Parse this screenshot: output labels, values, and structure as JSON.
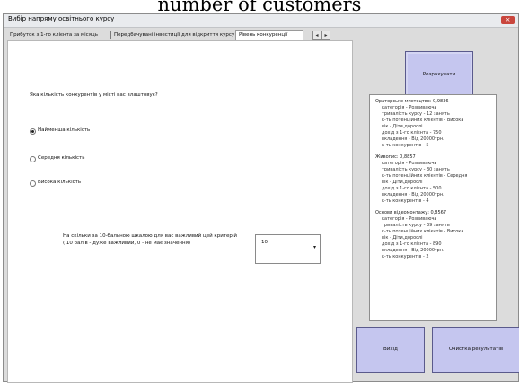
{
  "caption": "number of customers",
  "window": {
    "title": "Вибір напряму освітнього курсу",
    "close_label": "×"
  },
  "tabs": [
    {
      "label": "Прибуток з 1-го клієнта за місяць",
      "active": false
    },
    {
      "label": "Передбачувані інвестиції для відкриття курсу",
      "active": false
    },
    {
      "label": "Рівень конкуренції",
      "active": true
    }
  ],
  "tab_scroll": {
    "left": "◂",
    "right": "▸"
  },
  "panel": {
    "question": "Яка кількість конкурентів у місті вас влаштовує?",
    "options": [
      {
        "label": "Найменша кількість",
        "selected": true
      },
      {
        "label": "Середня кількість",
        "selected": false
      },
      {
        "label": "Висока кількість",
        "selected": false
      }
    ],
    "rate_label": [
      "На скільки за 10-бальною шкалою для вас важливий цей критерій",
      "( 10 балів - дуже важливий, 0 - не має значення)"
    ],
    "rate_value": "10",
    "rate_arrow": "▾"
  },
  "buttons": {
    "calculate": "Розрахувати",
    "exit": "Вихід",
    "clear": "Очистка результатів"
  },
  "results": [
    {
      "head": "Ораторське мистецтво: 0,9836",
      "lines": [
        "категорія - Розвиваюча",
        "тривалість курсу - 12 занять",
        "к-ть потенційних клієнтів - Висока",
        "вік - Діти,дорослі",
        "дохід з 1-го клієнта - 750",
        "вкладення - Від 20000грн.",
        "к-ть конкурентів - 5"
      ]
    },
    {
      "head": "Живопис: 0,8857",
      "lines": [
        "категорія - Розвиваюча",
        "тривалість курсу - 30 занять",
        "к-ть потенційних клієнтів - Середня",
        "вік - Діти,дорослі",
        "дохід з 1-го клієнта - 500",
        "вкладення - Від 20000грн.",
        "к-ть конкурентів - 4"
      ]
    },
    {
      "head": "Основи відеомонтажу: 0,8567",
      "lines": [
        "категорія - Розвиваюча",
        "тривалість курсу - 39 занять",
        "к-ть потенційних клієнтів - Висока",
        "вік - Діти,дорослі",
        "дохід з 1-го клієнта - 890",
        "вкладення - Від 20000грн.",
        "к-ть конкурентів - 2"
      ]
    }
  ]
}
